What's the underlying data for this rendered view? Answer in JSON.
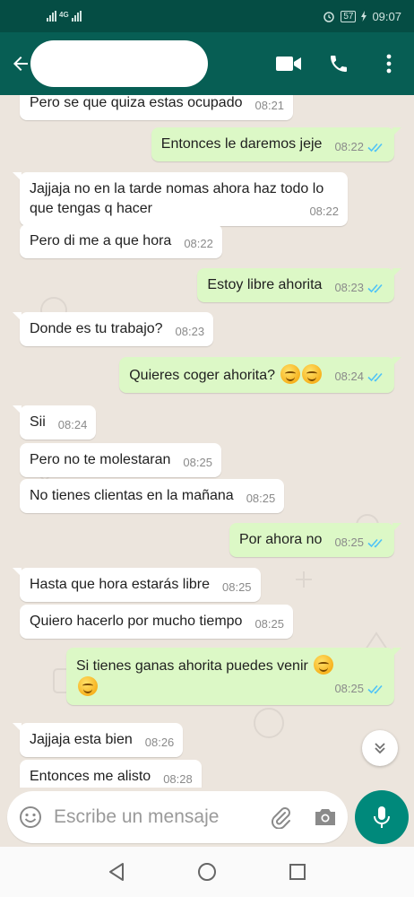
{
  "status_bar": {
    "network": "4G",
    "battery": "57",
    "time": "09:07"
  },
  "header": {
    "contact_name": ""
  },
  "messages": [
    {
      "dir": "in",
      "text": "Pero se que quiza estas ocupado",
      "time": "08:21"
    },
    {
      "dir": "out",
      "text": "Entonces le daremos jeje",
      "time": "08:22"
    },
    {
      "dir": "in",
      "text": "Jajjaja no en la tarde nomas ahora haz todo lo que tengas q hacer",
      "time": "08:22"
    },
    {
      "dir": "in",
      "text": "Pero di me a que hora",
      "time": "08:22"
    },
    {
      "dir": "out",
      "text": "Estoy libre ahorita",
      "time": "08:23"
    },
    {
      "dir": "in",
      "text": "Donde es tu trabajo?",
      "time": "08:23"
    },
    {
      "dir": "out",
      "text": "Quieres coger ahorita?",
      "time": "08:24"
    },
    {
      "dir": "in",
      "text": "Sii",
      "time": "08:24"
    },
    {
      "dir": "in",
      "text": "Pero no te molestaran",
      "time": "08:25"
    },
    {
      "dir": "in",
      "text": "No tienes clientas en la mañana",
      "time": "08:25"
    },
    {
      "dir": "out",
      "text": "Por ahora no",
      "time": "08:25"
    },
    {
      "dir": "in",
      "text": "Hasta que hora estarás libre",
      "time": "08:25"
    },
    {
      "dir": "in",
      "text": "Quiero hacerlo por mucho tiempo",
      "time": "08:25"
    },
    {
      "dir": "out",
      "text": "Si tienes ganas ahorita puedes venir",
      "time": "08:25"
    },
    {
      "dir": "in",
      "text": "Jajjaja esta bien",
      "time": "08:26"
    },
    {
      "dir": "in",
      "text": "Entonces me alisto",
      "time": "08:28"
    }
  ],
  "composer": {
    "placeholder": "Escribe un mensaje"
  },
  "colors": {
    "header": "#075e54",
    "status_bar": "#054d44",
    "outgoing": "#dcf8c6",
    "incoming": "#ffffff",
    "chat_bg": "#ece5dd",
    "read_ticks": "#4fc3f7",
    "mic": "#00897b"
  },
  "icons": [
    "back-arrow-icon",
    "video-call-icon",
    "phone-icon",
    "more-vert-icon",
    "double-check-icon",
    "smile-emoji-icon",
    "smirk-emoji-icon",
    "scroll-down-icon",
    "emoji-icon",
    "attach-icon",
    "camera-icon",
    "mic-icon",
    "nav-back-icon",
    "nav-home-icon",
    "nav-recents-icon"
  ]
}
